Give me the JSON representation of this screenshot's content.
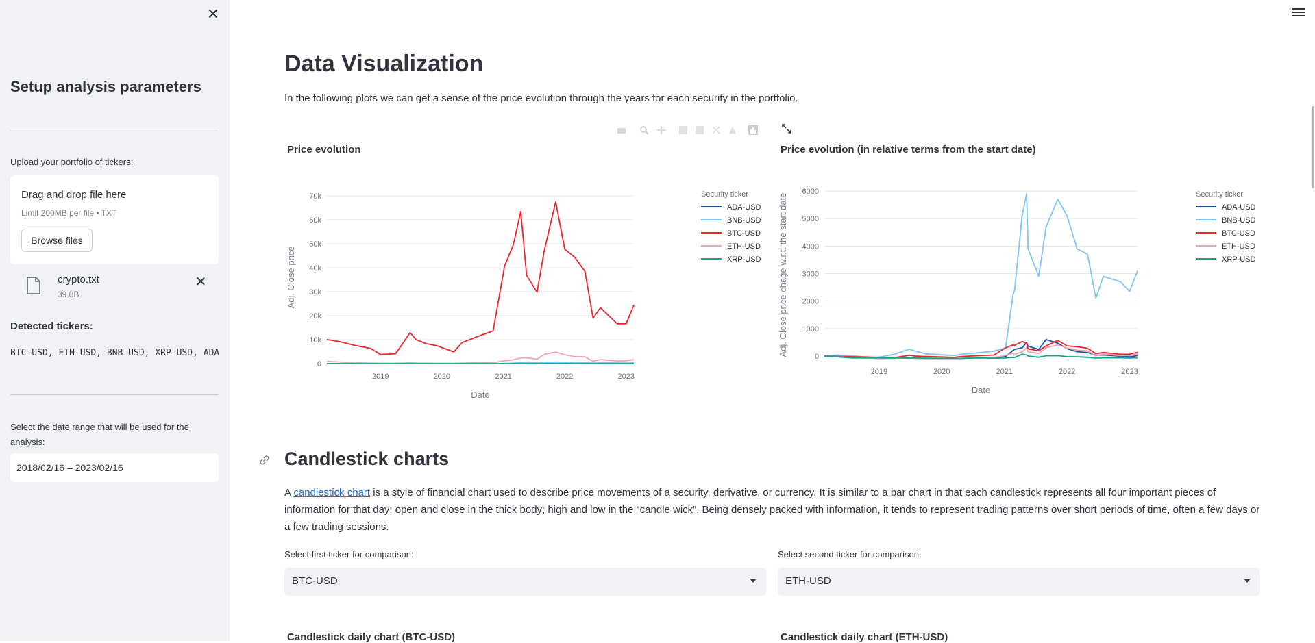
{
  "sidebar": {
    "close_icon": "close-icon",
    "title": "Setup analysis parameters",
    "upload_label": "Upload your portfolio of tickers:",
    "dropzone": {
      "title": "Drag and drop file here",
      "subtitle": "Limit 200MB per file • TXT",
      "browse_label": "Browse files"
    },
    "file": {
      "icon": "file-icon",
      "name": "crypto.txt",
      "size": "39.0B"
    },
    "detected_label": "Detected tickers:",
    "detected_tickers": "BTC-USD, ETH-USD, BNB-USD, XRP-USD, ADA-USD",
    "date_label": "Select the date range that will be used for the analysis:",
    "date_value": "2018/02/16 – 2023/02/16"
  },
  "main": {
    "title": "Data Visualization",
    "intro": "In the following plots we can get a sense of the price evolution through the years for each security in the portfolio.",
    "candlestick": {
      "title": "Candlestick charts",
      "para_prefix": "A ",
      "link_text": "candlestick chart",
      "para_rest": " is a style of financial chart used to describe price movements of a security, derivative, or currency. It is similar to a bar chart in that each candlestick represents all four important pieces of information for that day: open and close in the thick body; high and low in the “candle wick”. Being densely packed with information, it tends to represent trading patterns over short periods of time, often a few days or a few trading sessions.",
      "select1_label": "Select first ticker for comparison:",
      "select1_value": "BTC-USD",
      "select2_label": "Select second ticker for comparison:",
      "select2_value": "ETH-USD",
      "chart1_title": "Candlestick daily chart (BTC-USD)",
      "chart2_title": "Candlestick daily chart (ETH-USD)"
    }
  },
  "colors": {
    "ADA-USD": "#1f4eb4",
    "BNB-USD": "#7ec4f5",
    "BTC-USD": "#f2242b",
    "ETH-USD": "#f7a3a8",
    "XRP-USD": "#12a58a",
    "accent": "#1a6bd6",
    "sidebar_bg": "#f0f2f6"
  },
  "chart_data": [
    {
      "type": "line",
      "title": "Price evolution",
      "xlabel": "Date",
      "ylabel": "Adj. Close price",
      "legend_title": "Security ticker",
      "legend_position": "right",
      "grid": true,
      "xlim": [
        "2018-02-16",
        "2023-02-16"
      ],
      "ylim": [
        0,
        72000
      ],
      "x_ticks": [
        "2019",
        "2020",
        "2021",
        "2022",
        "2023"
      ],
      "y_ticks": [
        "0",
        "10k",
        "20k",
        "30k",
        "40k",
        "50k",
        "60k",
        "70k"
      ],
      "x": [
        "2018-02-16",
        "2018-05-01",
        "2018-08-01",
        "2018-11-01",
        "2019-01-01",
        "2019-04-01",
        "2019-06-26",
        "2019-08-01",
        "2019-10-01",
        "2019-12-01",
        "2020-03-12",
        "2020-05-01",
        "2020-08-01",
        "2020-11-01",
        "2021-01-08",
        "2021-03-01",
        "2021-04-14",
        "2021-05-19",
        "2021-07-20",
        "2021-09-01",
        "2021-11-08",
        "2022-01-01",
        "2022-03-01",
        "2022-05-01",
        "2022-06-18",
        "2022-08-01",
        "2022-11-09",
        "2023-01-01",
        "2023-02-16"
      ],
      "series": [
        {
          "name": "ADA-USD",
          "values": [
            0.35,
            0.3,
            0.15,
            0.1,
            0.04,
            0.08,
            0.09,
            0.07,
            0.04,
            0.04,
            0.03,
            0.05,
            0.13,
            0.1,
            0.3,
            1.2,
            1.4,
            1.6,
            1.2,
            2.5,
            2.0,
            1.3,
            0.9,
            0.8,
            0.45,
            0.5,
            0.33,
            0.25,
            0.4
          ]
        },
        {
          "name": "BNB-USD",
          "values": [
            10,
            14,
            11,
            6,
            6,
            17,
            35,
            28,
            18,
            16,
            12,
            17,
            22,
            28,
            40,
            250,
            520,
            400,
            300,
            480,
            650,
            520,
            400,
            380,
            220,
            300,
            280,
            245,
            320
          ]
        },
        {
          "name": "BTC-USD",
          "values": [
            10100,
            9200,
            7600,
            6400,
            3800,
            4100,
            12900,
            10000,
            8300,
            7500,
            4900,
            8800,
            11300,
            13700,
            40700,
            49600,
            63500,
            36800,
            29800,
            47100,
            67500,
            47700,
            44400,
            38500,
            19000,
            23300,
            16600,
            16600,
            24500
          ]
        },
        {
          "name": "ETH-USD",
          "values": [
            950,
            690,
            410,
            200,
            130,
            140,
            330,
            220,
            180,
            150,
            110,
            210,
            390,
            390,
            1200,
            1570,
            2430,
            2430,
            1850,
            3850,
            4800,
            3700,
            2950,
            2800,
            1000,
            1700,
            1100,
            1200,
            1700
          ]
        },
        {
          "name": "XRP-USD",
          "values": [
            1.1,
            0.8,
            0.3,
            0.4,
            0.35,
            0.3,
            0.5,
            0.3,
            0.25,
            0.22,
            0.15,
            0.2,
            0.3,
            0.25,
            0.3,
            0.5,
            1.9,
            1.1,
            0.6,
            1.2,
            1.25,
            0.85,
            0.8,
            0.6,
            0.32,
            0.37,
            0.38,
            0.34,
            0.39
          ]
        }
      ]
    },
    {
      "type": "line",
      "title": "Price evolution (in relative terms from the start date)",
      "xlabel": "Date",
      "ylabel": "Adj. Close price chage w.r.t. the start date",
      "legend_title": "Security ticker",
      "legend_position": "right",
      "grid": true,
      "xlim": [
        "2018-02-16",
        "2023-02-16"
      ],
      "ylim": [
        -100,
        6000
      ],
      "x_ticks": [
        "2019",
        "2020",
        "2021",
        "2022",
        "2023"
      ],
      "y_ticks": [
        "0",
        "1000",
        "2000",
        "3000",
        "4000",
        "5000",
        "6000"
      ],
      "x": [
        "2018-02-16",
        "2018-05-01",
        "2018-08-01",
        "2018-11-01",
        "2019-01-01",
        "2019-04-01",
        "2019-06-26",
        "2019-08-01",
        "2019-10-01",
        "2019-12-01",
        "2020-03-12",
        "2020-05-01",
        "2020-08-01",
        "2020-11-01",
        "2021-01-08",
        "2021-02-19",
        "2021-03-01",
        "2021-04-14",
        "2021-05-10",
        "2021-05-19",
        "2021-07-20",
        "2021-09-01",
        "2021-11-08",
        "2022-01-01",
        "2022-03-01",
        "2022-05-01",
        "2022-06-18",
        "2022-08-01",
        "2022-11-09",
        "2023-01-01",
        "2023-02-16"
      ],
      "series": [
        {
          "name": "ADA-USD",
          "values": [
            0,
            -15,
            -55,
            -70,
            -88,
            -77,
            -74,
            -80,
            -88,
            -88,
            -91,
            -85,
            -60,
            -70,
            -15,
            200,
            240,
            300,
            500,
            360,
            240,
            600,
            470,
            270,
            160,
            130,
            30,
            40,
            -5,
            -30,
            15
          ]
        },
        {
          "name": "BNB-USD",
          "values": [
            0,
            40,
            10,
            -40,
            -40,
            70,
            250,
            180,
            80,
            60,
            20,
            70,
            120,
            180,
            300,
            2200,
            2400,
            5100,
            5900,
            3900,
            2900,
            4700,
            5700,
            5100,
            3900,
            3700,
            2100,
            2900,
            2700,
            2350,
            3100
          ]
        },
        {
          "name": "BTC-USD",
          "values": [
            0,
            -9,
            -25,
            -37,
            -62,
            -59,
            28,
            -1,
            -18,
            -26,
            -51,
            -13,
            12,
            36,
            300,
            400,
            390,
            530,
            460,
            260,
            195,
            370,
            570,
            370,
            340,
            280,
            90,
            130,
            65,
            65,
            140
          ]
        },
        {
          "name": "ETH-USD",
          "values": [
            0,
            -27,
            -57,
            -79,
            -86,
            -85,
            -65,
            -77,
            -81,
            -84,
            -88,
            -78,
            -59,
            -59,
            26,
            100,
            65,
            155,
            300,
            155,
            95,
            305,
            405,
            290,
            210,
            195,
            5,
            80,
            15,
            25,
            80
          ]
        },
        {
          "name": "XRP-USD",
          "values": [
            0,
            -27,
            -73,
            -64,
            -68,
            -73,
            -55,
            -73,
            -77,
            -80,
            -86,
            -82,
            -73,
            -77,
            -73,
            -50,
            -55,
            70,
            40,
            0,
            -45,
            10,
            15,
            -23,
            -27,
            -45,
            -71,
            -66,
            -65,
            -69,
            -65
          ]
        }
      ]
    }
  ]
}
